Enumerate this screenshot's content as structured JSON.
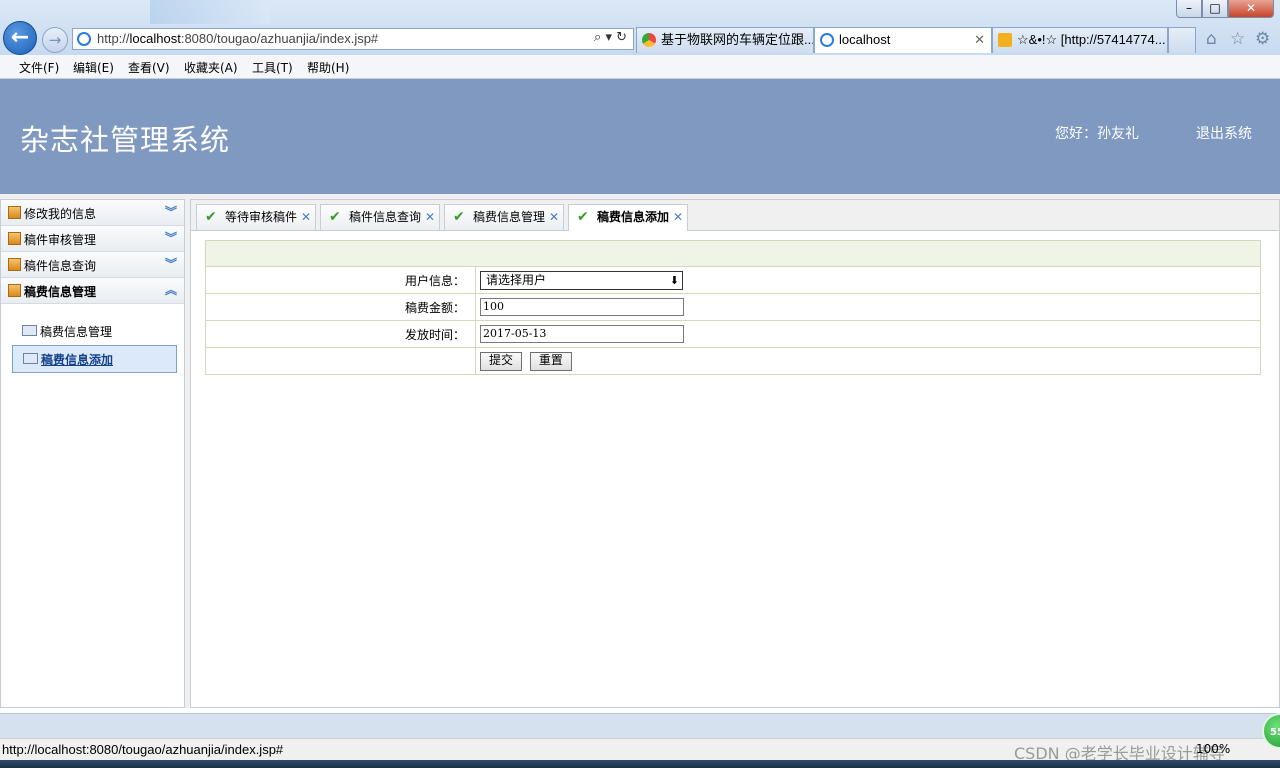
{
  "browser": {
    "address_url_prefix": "http://",
    "address_url_host": "localhost",
    "address_url_rest": ":8080/tougao/azhuanjia/index.jsp#",
    "tabs": [
      {
        "label": "基于物联网的车辆定位跟..."
      },
      {
        "label": "localhost"
      },
      {
        "label": "☆&•!☆ [http://57414774..."
      }
    ],
    "menu": [
      "文件(F)",
      "编辑(E)",
      "查看(V)",
      "收藏夹(A)",
      "工具(T)",
      "帮助(H)"
    ],
    "status_url": "http://localhost:8080/tougao/azhuanjia/index.jsp#",
    "zoom": "100%",
    "badge_text": "55"
  },
  "app": {
    "title": "杂志社管理系统",
    "greeting": "您好：孙友礼",
    "logout": "退出系统"
  },
  "sidebar": {
    "sections": [
      {
        "label": "修改我的信息"
      },
      {
        "label": "稿件审核管理"
      },
      {
        "label": "稿件信息查询"
      },
      {
        "label": "稿费信息管理"
      }
    ],
    "sub_items": [
      {
        "label": "稿费信息管理"
      },
      {
        "label": "稿费信息添加"
      }
    ]
  },
  "tabs": [
    {
      "label": "等待审核稿件"
    },
    {
      "label": "稿件信息查询"
    },
    {
      "label": "稿费信息管理"
    },
    {
      "label": "稿费信息添加"
    }
  ],
  "form": {
    "user_label": "用户信息：",
    "user_value": "请选择用户",
    "amount_label": "稿费金额：",
    "amount_value": "100",
    "date_label": "发放时间：",
    "date_value": "2017-05-13",
    "submit": "提交",
    "reset": "重置"
  },
  "watermark": "CSDN @老学长毕业设计辅导",
  "colors": {
    "header_bg": "#7f99c1",
    "active_sub_bg": "#dbe9fb",
    "form_header_bg": "#eff4e7"
  }
}
